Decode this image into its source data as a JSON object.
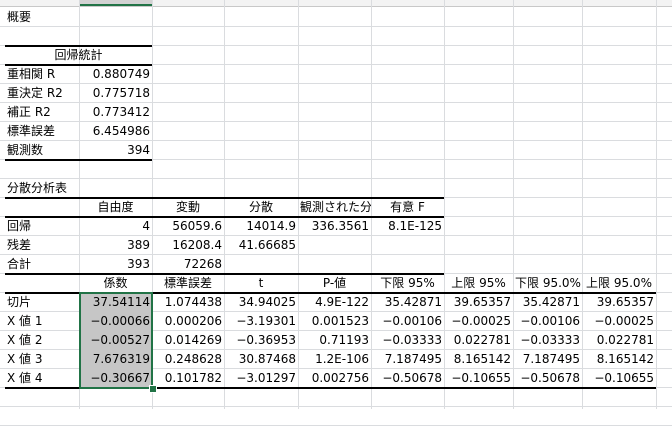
{
  "sheet": {
    "summary_title": "概要",
    "regression_stats": {
      "header": "回帰統計",
      "rows": [
        {
          "label": "重相関 R",
          "value": "0.880749"
        },
        {
          "label": "重決定 R2",
          "value": "0.775718"
        },
        {
          "label": "補正 R2",
          "value": "0.773412"
        },
        {
          "label": "標準誤差",
          "value": "6.454986"
        },
        {
          "label": "観測数",
          "value": "394"
        }
      ]
    },
    "anova": {
      "title": "分散分析表",
      "headers": [
        "自由度",
        "変動",
        "分散",
        "観測された分散比",
        "有意 F"
      ],
      "rows": [
        {
          "label": "回帰",
          "cells": [
            "4",
            "56059.6",
            "14014.9",
            "336.3561",
            "8.1E-125"
          ]
        },
        {
          "label": "残差",
          "cells": [
            "389",
            "16208.4",
            "41.66685",
            "",
            ""
          ]
        },
        {
          "label": "合計",
          "cells": [
            "393",
            "72268",
            "",
            "",
            ""
          ]
        }
      ]
    },
    "coefficients": {
      "headers": [
        "係数",
        "標準誤差",
        "t",
        "P-値",
        "下限 95%",
        "上限 95%",
        "下限 95.0%",
        "上限 95.0%"
      ],
      "rows": [
        {
          "label": "切片",
          "cells": [
            "37.54114",
            "1.074438",
            "34.94025",
            "4.9E-122",
            "35.42871",
            "39.65357",
            "35.42871",
            "39.65357"
          ]
        },
        {
          "label": "X 値 1",
          "cells": [
            "-0.00066",
            "0.000206",
            "-3.19301",
            "0.001523",
            "-0.00106",
            "-0.00025",
            "-0.00106",
            "-0.00025"
          ]
        },
        {
          "label": "X 値 2",
          "cells": [
            "-0.00527",
            "0.014269",
            "-0.36953",
            "0.71193",
            "-0.03333",
            "0.022781",
            "-0.03333",
            "0.022781"
          ]
        },
        {
          "label": "X 値 3",
          "cells": [
            "7.676319",
            "0.248628",
            "30.87468",
            "1.2E-106",
            "7.187495",
            "8.165142",
            "7.187495",
            "8.165142"
          ]
        },
        {
          "label": "X 値 4",
          "cells": [
            "-0.30667",
            "0.101782",
            "-3.01297",
            "0.002756",
            "-0.50678",
            "-0.10655",
            "-0.50678",
            "-0.10655"
          ]
        }
      ]
    }
  }
}
